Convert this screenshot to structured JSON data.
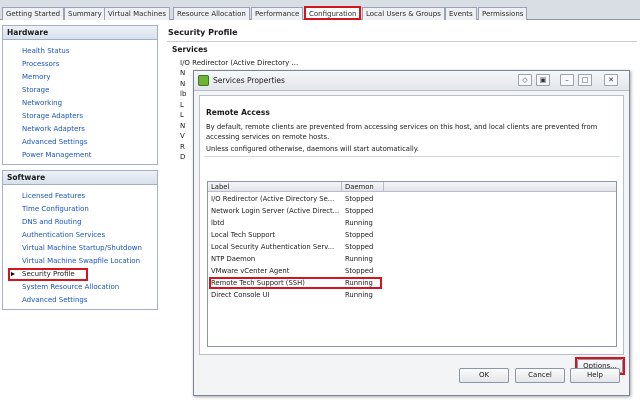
{
  "tabs": [
    {
      "label": "Getting Started"
    },
    {
      "label": "Summary"
    },
    {
      "label": "Virtual Machines"
    },
    {
      "label": "Resource Allocation"
    },
    {
      "label": "Performance"
    },
    {
      "label": "Configuration",
      "active": true
    },
    {
      "label": "Local Users & Groups"
    },
    {
      "label": "Events"
    },
    {
      "label": "Permissions"
    }
  ],
  "hardware": {
    "header": "Hardware",
    "items": [
      "Health Status",
      "Processors",
      "Memory",
      "Storage",
      "Networking",
      "Storage Adapters",
      "Network Adapters",
      "Advanced Settings",
      "Power Management"
    ]
  },
  "software": {
    "header": "Software",
    "items": [
      "Licensed Features",
      "Time Configuration",
      "DNS and Routing",
      "Authentication Services",
      "Virtual Machine Startup/Shutdown",
      "Virtual Machine Swapfile Location",
      "Security Profile",
      "System Resource Allocation",
      "Advanced Settings"
    ],
    "selected": "Security Profile"
  },
  "main": {
    "title": "Security Profile",
    "section": "Services",
    "first_service": "I/O Redirector (Active Directory ...",
    "partial_letters": [
      "N",
      "N",
      "lb",
      "L",
      "L",
      "N",
      "V",
      "R",
      "D"
    ]
  },
  "dialog": {
    "title": "Services Properties",
    "remote_access_title": "Remote Access",
    "description": "By default, remote clients are prevented from accessing services on this host, and local clients are prevented from accessing services on remote hosts.",
    "note": "Unless configured otherwise, daemons will start automatically.",
    "columns": {
      "label": "Label",
      "daemon": "Daemon"
    },
    "services": [
      {
        "label": "I/O Redirector (Active Directory Se...",
        "daemon": "Stopped"
      },
      {
        "label": "Network Login Server (Active Direct...",
        "daemon": "Stopped"
      },
      {
        "label": "lbtd",
        "daemon": "Running"
      },
      {
        "label": "Local Tech Support",
        "daemon": "Stopped"
      },
      {
        "label": "Local Security Authentication Serv...",
        "daemon": "Stopped"
      },
      {
        "label": "NTP Daemon",
        "daemon": "Running"
      },
      {
        "label": "VMware vCenter Agent",
        "daemon": "Stopped"
      },
      {
        "label": "Remote Tech Support (SSH)",
        "daemon": "Running",
        "highlighted": true
      },
      {
        "label": "Direct Console UI",
        "daemon": "Running"
      }
    ],
    "options_label": "Options...",
    "ok_label": "OK",
    "cancel_label": "Cancel",
    "help_label": "Help"
  },
  "colors": {
    "highlight": "#d6141d",
    "link": "#1a56b8",
    "accent_green": "#6fb43a"
  }
}
